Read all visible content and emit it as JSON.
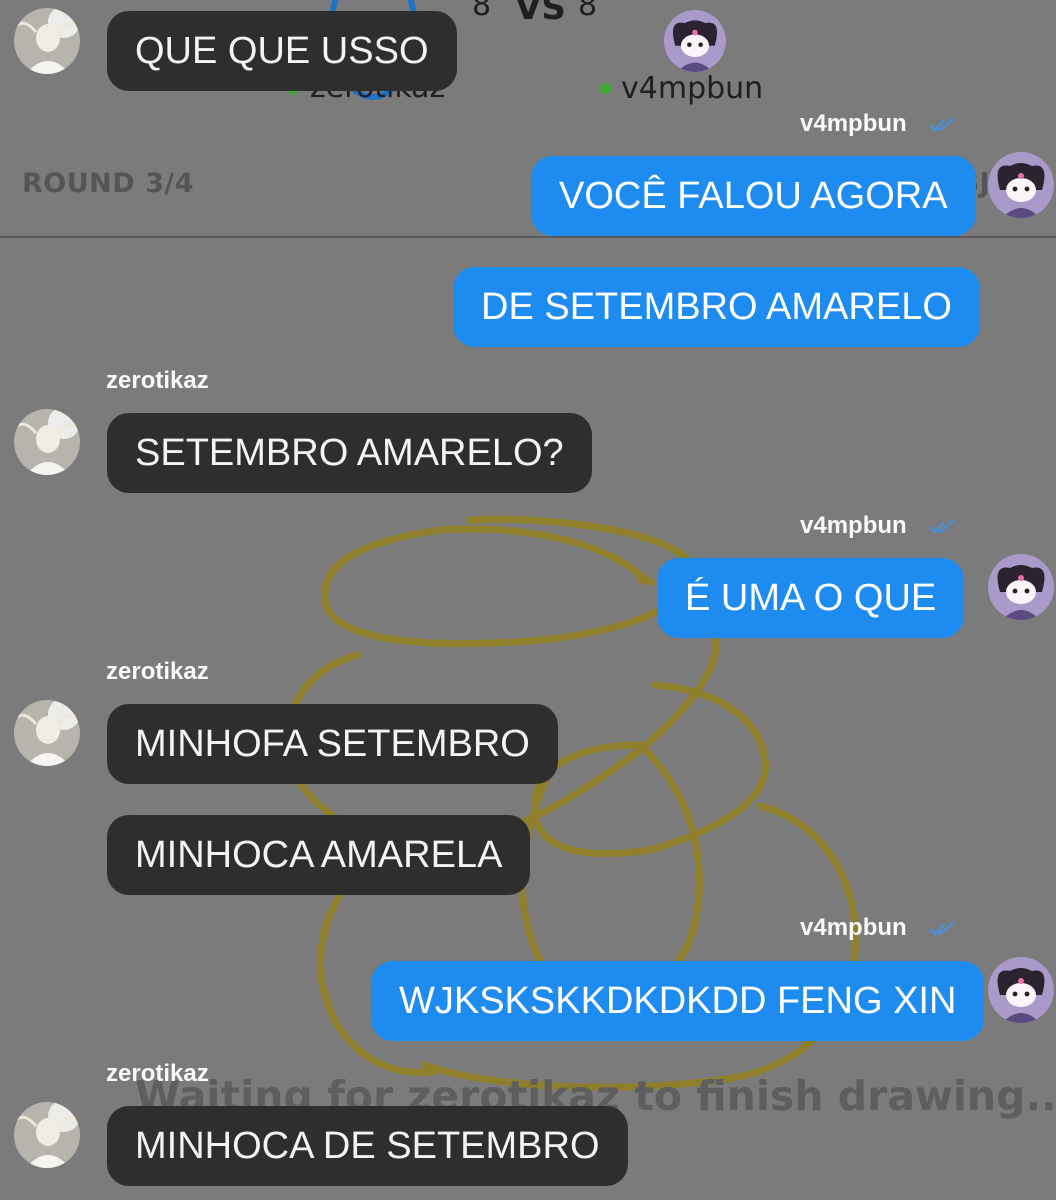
{
  "game": {
    "vs_label": "VS",
    "left_glyph": "8",
    "right_glyph": "8",
    "player_left": "zerotikaz",
    "player_right": "v4mpbun",
    "round": "ROUND 3/4",
    "round_right_text": "BJ",
    "waiting": "Waiting for zerotikaz to finish drawing..."
  },
  "chat": {
    "messages": [
      {
        "side": "in",
        "text": "QUE QUE USSO"
      },
      {
        "side": "out",
        "sender": "v4mpbun",
        "text": "VOCÊ FALOU AGORA"
      },
      {
        "side": "out",
        "text": "DE SETEMBRO AMARELO"
      },
      {
        "side": "in",
        "sender": "zerotikaz",
        "text": "SETEMBRO AMARELO?"
      },
      {
        "side": "out",
        "sender": "v4mpbun",
        "text": "É UMA O QUE"
      },
      {
        "side": "in",
        "sender": "zerotikaz",
        "text": "MINHOFA SETEMBRO"
      },
      {
        "side": "in",
        "text": "MINHOCA AMARELA"
      },
      {
        "side": "out",
        "sender": "v4mpbun",
        "text": "WJKSKSKKDKDKDD FENG XIN"
      },
      {
        "side": "in",
        "sender": "zerotikaz",
        "text": "MINHOCA DE SETEMBRO"
      }
    ]
  },
  "colors": {
    "background": "#7b7b7b",
    "incoming_bubble": "#2e2e2e",
    "outgoing_bubble": "#1d8bf0",
    "drawing_stroke": "#8f7f2a",
    "read_check": "#4a8fd8",
    "online": "#3aa832"
  },
  "icons": {
    "read_receipt": "double-check-icon",
    "avatar_zerotikaz": "photo-avatar",
    "avatar_v4mpbun": "kuromi-avatar"
  }
}
